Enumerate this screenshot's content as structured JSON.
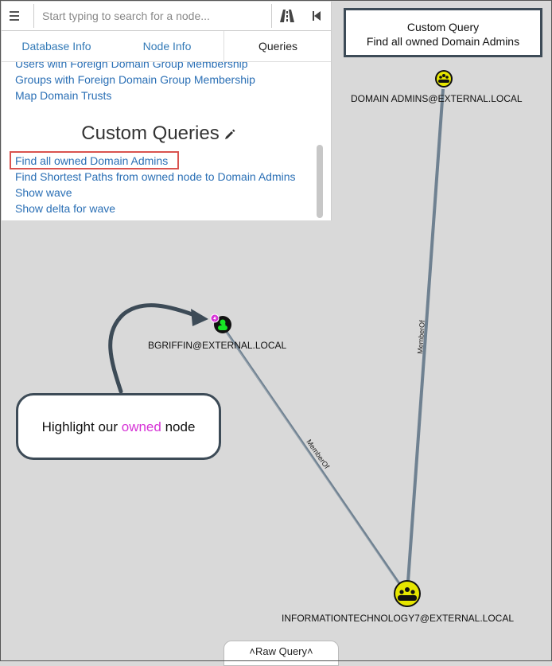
{
  "search": {
    "placeholder": "Start typing to search for a node..."
  },
  "tabs": [
    {
      "label": "Database Info"
    },
    {
      "label": "Node Info"
    },
    {
      "label": "Queries"
    }
  ],
  "queries": {
    "prebuilt": [
      "Users with Foreign Domain Group Membership",
      "Groups with Foreign Domain Group Membership",
      "Map Domain Trusts"
    ],
    "custom_title": "Custom Queries",
    "custom": [
      "Find all owned Domain Admins",
      "Find Shortest Paths from owned node to Domain Admins",
      "Show wave",
      "Show delta for wave"
    ]
  },
  "query_label": {
    "line1": "Custom Query",
    "line2": "Find all owned Domain Admins"
  },
  "callout": {
    "before": "Highlight our ",
    "highlight": "owned",
    "after": " node"
  },
  "graph": {
    "nodes": {
      "domain_admins": "DOMAIN ADMINS@EXTERNAL.LOCAL",
      "bgriffin": "BGRIFFIN@EXTERNAL.LOCAL",
      "it7": "INFORMATIONTECHNOLOGY7@EXTERNAL.LOCAL"
    },
    "edges": {
      "edge1": "MemberOf",
      "edge2": "MemberOf"
    }
  },
  "raw_query": {
    "label": "Raw Query"
  },
  "colors": {
    "group_node": "#e6e600",
    "user_node": "#17e625",
    "owned_badge": "#d633d6",
    "link": "#2a6fb5",
    "edge": "#6f8191"
  }
}
